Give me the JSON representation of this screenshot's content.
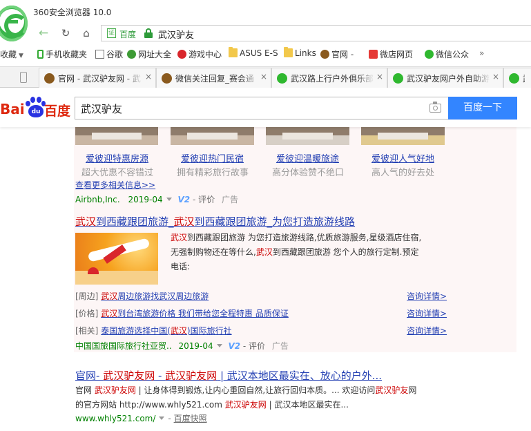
{
  "window": {
    "title": "360安全浏览器 10.0"
  },
  "address": {
    "cert_label": "百度",
    "url": "武汉驴友"
  },
  "bookmarks": [
    {
      "label": "收藏",
      "icon": "star-icon"
    },
    {
      "label": "手机收藏夹",
      "icon": "phone-icon"
    },
    {
      "label": "谷歌",
      "icon": "doc-icon"
    },
    {
      "label": "网址大全",
      "icon": "nav-icon"
    },
    {
      "label": "游戏中心",
      "icon": "game-icon"
    },
    {
      "label": "ASUS E-S",
      "icon": "folder-icon"
    },
    {
      "label": "Links",
      "icon": "folder-icon"
    },
    {
      "label": "官网 -",
      "icon": "site-icon"
    },
    {
      "label": "微店网页",
      "icon": "weidian-icon"
    },
    {
      "label": "微信公众",
      "icon": "wechat-icon"
    }
  ],
  "tabs": [
    {
      "label": "官网 - 武汉驴友网 - 武",
      "icon_color": "#8a5a1e"
    },
    {
      "label": "微信关注回复_赛会通",
      "icon_color": "#8a5a1e"
    },
    {
      "label": "武汉路上行户外俱乐部",
      "icon_color": "#2fb82f"
    },
    {
      "label": "武汉驴友网户外自助游",
      "icon_color": "#2fb82f"
    },
    {
      "label": "武",
      "icon_color": "#2fb82f"
    }
  ],
  "baidu": {
    "logo_left": "Bai",
    "logo_paw": "du",
    "logo_right": "百度",
    "query": "武汉驴友",
    "search_button": "百度一下"
  },
  "ad_cards": [
    {
      "title": "爱彼迎特惠房源",
      "subtitle": "超大优惠不容错过"
    },
    {
      "title": "爱彼迎热门民宿",
      "subtitle": "拥有精彩旅行故事"
    },
    {
      "title": "爱彼迎温暖旅途",
      "subtitle": "高分体验赞不绝口"
    },
    {
      "title": "爱彼迎人气好地",
      "subtitle": "高人气的好去处"
    }
  ],
  "ad1": {
    "more_link": "查看更多相关信息>>",
    "source": "Airbnb,Inc.",
    "date": "2019-04",
    "v2": "V2",
    "review": "- 评价",
    "ad_tag": "广告"
  },
  "ad2": {
    "title_parts": [
      "武汉",
      "到西藏跟团旅游_",
      "武汉",
      "到西藏跟团旅游_为您打造旅游线路"
    ],
    "desc_line1": [
      "武汉",
      "到西藏跟团旅游 为您打造旅游线路,优质旅游服务,星级酒店住宿,"
    ],
    "desc_line2": [
      "无强制购物还在等什么,",
      "武汉",
      "到西藏跟团旅游 您个人的旅行定制.预定"
    ],
    "desc_line3": "电话:",
    "rows": [
      {
        "tag": "[周边]",
        "pre": "",
        "hl": "武汉",
        "post": "周边旅游找武汉周边旅游",
        "detail": "咨询详情>"
      },
      {
        "tag": "[价格]",
        "pre": "",
        "hl": "武汉",
        "post": "到台湾旅游价格 我们带给您全程特惠 品质保证",
        "detail": "咨询详情>"
      },
      {
        "tag": "[相关]",
        "pre": "泰国旅游选择中国(",
        "hl": "武汉",
        "post": ")国际旅行社",
        "detail": "咨询详情>"
      }
    ],
    "source": "中国国旅国际旅行社亚贸..",
    "date": "2019-04",
    "v2": "V2",
    "review": "- 评价",
    "ad_tag": "广告"
  },
  "result1": {
    "title_parts": [
      "官网- ",
      "武汉驴友网",
      " - ",
      "武汉驴友网",
      " | 武汉本地区最实在、放心的户外..."
    ],
    "line1": [
      "官网 ",
      "武汉驴友网",
      " | 让身体得到锻炼,让内心重回自然,让旅行回归本质。... 欢迎访问",
      "武汉驴友",
      "网"
    ],
    "line2": [
      "的官方网站 http://www.whly521.com ",
      "武汉驴友网",
      " | 武汉本地区最实在..."
    ],
    "url": "www.whly521.com/",
    "snapshot": "百度快照"
  }
}
